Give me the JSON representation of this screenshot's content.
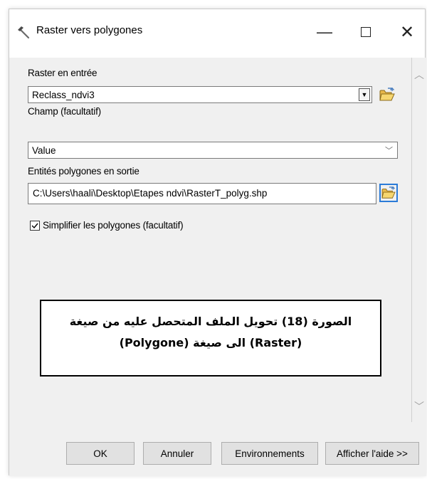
{
  "window": {
    "title": "Raster vers polygones",
    "minimize_glyph": "—",
    "close_glyph": "✕",
    "icon": "hammer-icon"
  },
  "form": {
    "raster_label": "Raster en entrée",
    "raster_value": "Reclass_ndvi3",
    "field_label": "Champ (facultatif)",
    "field_value": "Value",
    "output_label": "Entités polygones en sortie",
    "output_value": "C:\\Users\\haali\\Desktop\\Etapes ndvi\\RasterT_polyg.shp",
    "simplify_label": "Simplifier les polygones (facultatif)",
    "simplify_checked": true
  },
  "caption": {
    "line1": "الصورة (18) تحويل الملف المتحصل عليه من صيغة",
    "line2": "(Raster) الى صيغة (Polygone)"
  },
  "buttons": {
    "ok": "OK",
    "cancel": "Annuler",
    "environments": "Environnements",
    "help": "Afficher l'aide >>"
  },
  "colors": {
    "focus_border": "#2b7bd8",
    "folder_yellow": "#f2c94c"
  }
}
